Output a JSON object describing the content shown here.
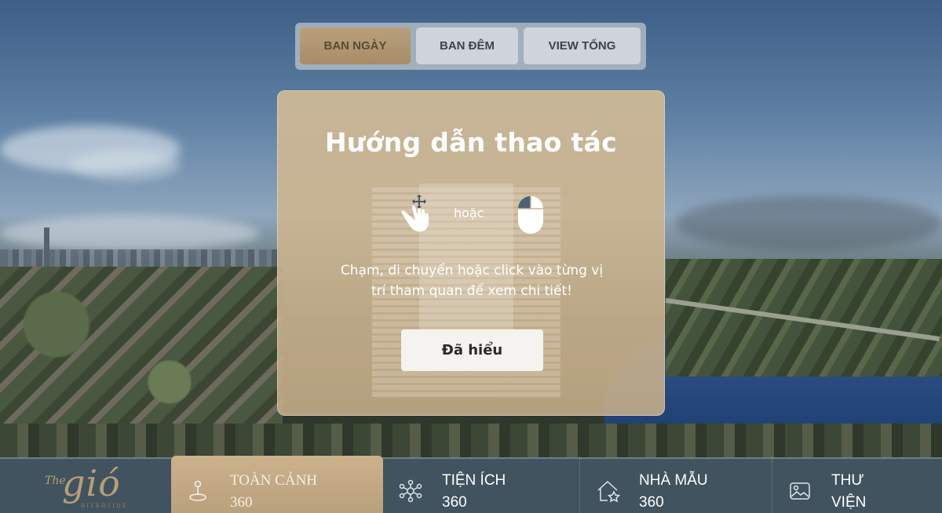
{
  "top_tabs": [
    {
      "label": "BAN NGÀY",
      "active": true
    },
    {
      "label": "BAN ĐÊM",
      "active": false
    },
    {
      "label": "VIEW TỔNG",
      "active": false
    }
  ],
  "modal": {
    "title": "Hướng dẫn thao tác",
    "or_text": "hoặc",
    "description_line1": "Chạm, di chuyển hoặc click vào từng vị",
    "description_line2": "trí tham quan để xem chi tiết!",
    "confirm_label": "Đã hiểu",
    "icons": [
      "touch-move-icon",
      "mouse-click-icon"
    ]
  },
  "logo": {
    "the": "The",
    "name": "gió",
    "sub": "RIVERSIDE"
  },
  "bottom_nav": [
    {
      "label1": "TOÀN CẢNH",
      "label2": "360",
      "icon": "person-360-icon",
      "active": true
    },
    {
      "label1": "TIỆN ÍCH",
      "label2": "360",
      "icon": "network-icon",
      "active": false
    },
    {
      "label1": "NHÀ MẪU",
      "label2": "360",
      "icon": "house-star-icon",
      "active": false
    },
    {
      "label1": "THƯ",
      "label2": "VIỆN",
      "icon": "gallery-icon",
      "active": false
    }
  ],
  "colors": {
    "accent_gold": "#b9a07c",
    "nav_bg": "#425462",
    "modal_bg": "#d0ba96"
  }
}
